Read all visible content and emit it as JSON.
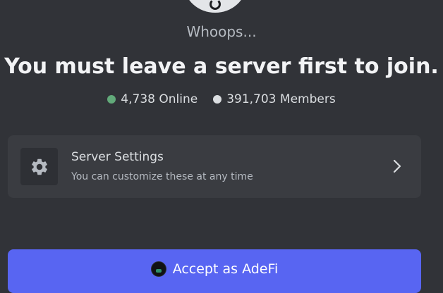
{
  "header": {
    "whoops": "Whoops...",
    "title": "You must leave a server first to join."
  },
  "stats": {
    "online": "4,738 Online",
    "members": "391,703 Members",
    "online_color": "#6bbf86",
    "members_color": "#dbdee1"
  },
  "settings_card": {
    "icon": "gear-icon",
    "title": "Server Settings",
    "subtitle": "You can customize these at any time"
  },
  "accept": {
    "label": "Accept as AdeFi",
    "color": "#5865f2"
  }
}
